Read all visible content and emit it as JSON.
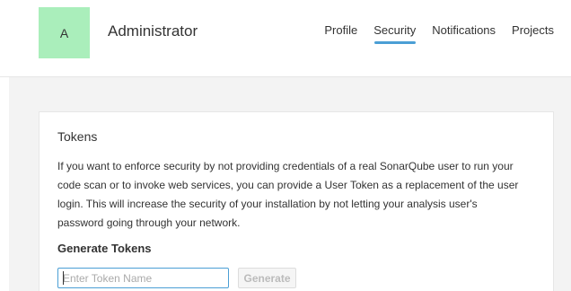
{
  "header": {
    "avatar_letter": "A",
    "user_name": "Administrator",
    "nav": [
      {
        "label": "Profile",
        "active": false
      },
      {
        "label": "Security",
        "active": true
      },
      {
        "label": "Notifications",
        "active": false
      },
      {
        "label": "Projects",
        "active": false
      }
    ]
  },
  "tokens": {
    "title": "Tokens",
    "description": "If you want to enforce security by not providing credentials of a real SonarQube user to run your code scan or to invoke web services, you can provide a User Token as a replacement of the user login. This will increase the security of your installation by not letting your analysis user's password going through your network.",
    "generate_title": "Generate Tokens",
    "input_value": "",
    "input_placeholder": "Enter Token Name",
    "generate_label": "Generate"
  },
  "colors": {
    "avatar_bg": "#aaeebb",
    "accent": "#4b9fd5",
    "main_bg": "#f3f3f3"
  }
}
